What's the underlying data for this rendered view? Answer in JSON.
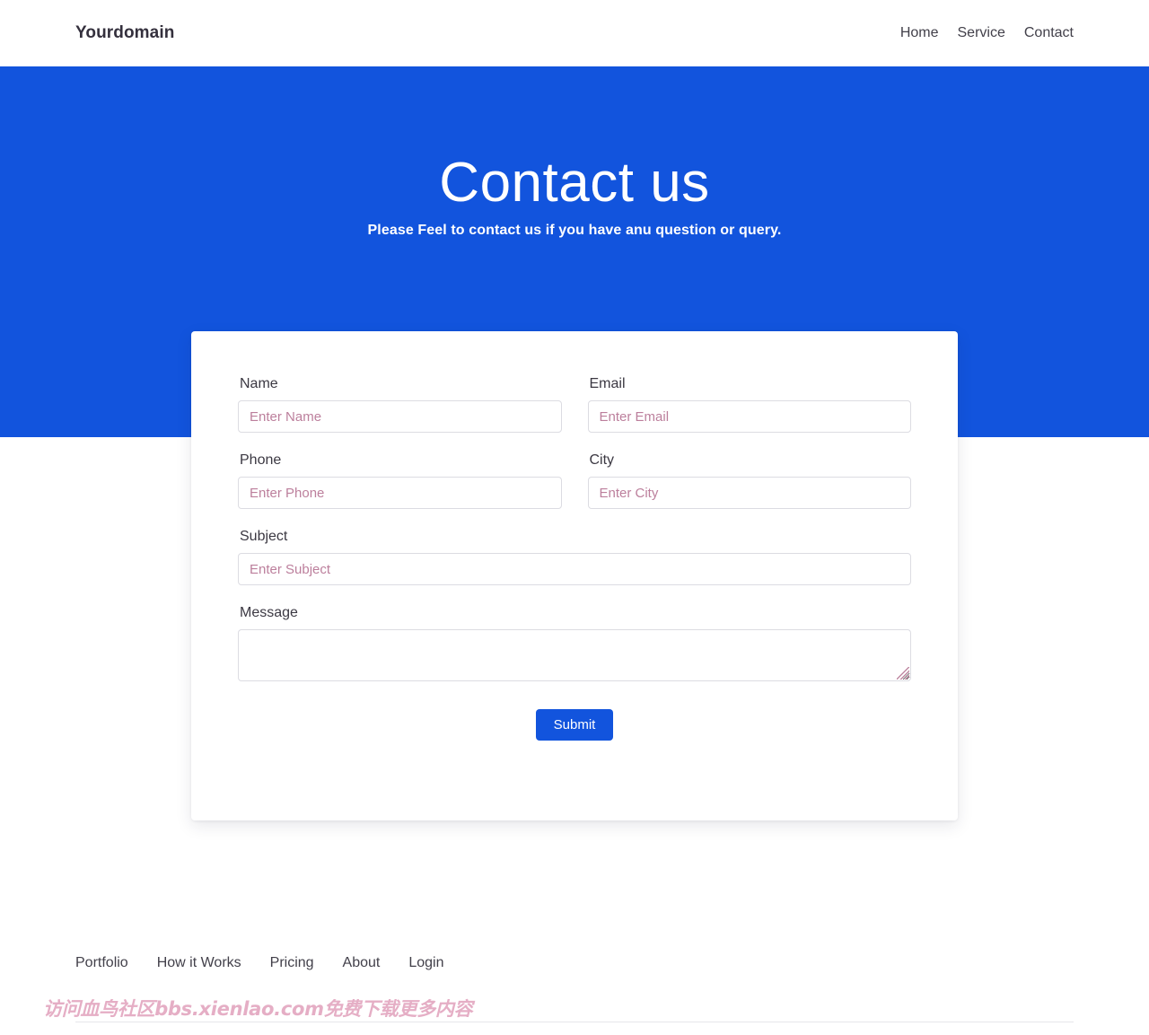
{
  "navbar": {
    "brand": "Yourdomain",
    "links": [
      {
        "label": "Home"
      },
      {
        "label": "Service"
      },
      {
        "label": "Contact"
      }
    ]
  },
  "hero": {
    "title": "Contact us",
    "subtitle": "Please Feel to contact us if you have anu question or query.",
    "background_color": "#1254dd"
  },
  "form": {
    "fields": [
      {
        "label": "Name",
        "placeholder": "Enter Name",
        "value": ""
      },
      {
        "label": "Email",
        "placeholder": "Enter Email",
        "value": ""
      },
      {
        "label": "Phone",
        "placeholder": "Enter Phone",
        "value": ""
      },
      {
        "label": "City",
        "placeholder": "Enter City",
        "value": ""
      },
      {
        "label": "Subject",
        "placeholder": "Enter Subject",
        "value": ""
      }
    ],
    "message": {
      "label": "Message",
      "placeholder": "",
      "value": ""
    },
    "submit_label": "Submit",
    "submit_color": "#1254dd",
    "placeholder_color": "#bc7f9c"
  },
  "footer": {
    "links": [
      {
        "label": "Portfolio"
      },
      {
        "label": "How it Works"
      },
      {
        "label": "Pricing"
      },
      {
        "label": "About"
      },
      {
        "label": "Login"
      }
    ]
  },
  "watermark": {
    "text": "访问血鸟社区bbs.xienlao.com免费下载更多内容",
    "color": "#e5aec5"
  }
}
